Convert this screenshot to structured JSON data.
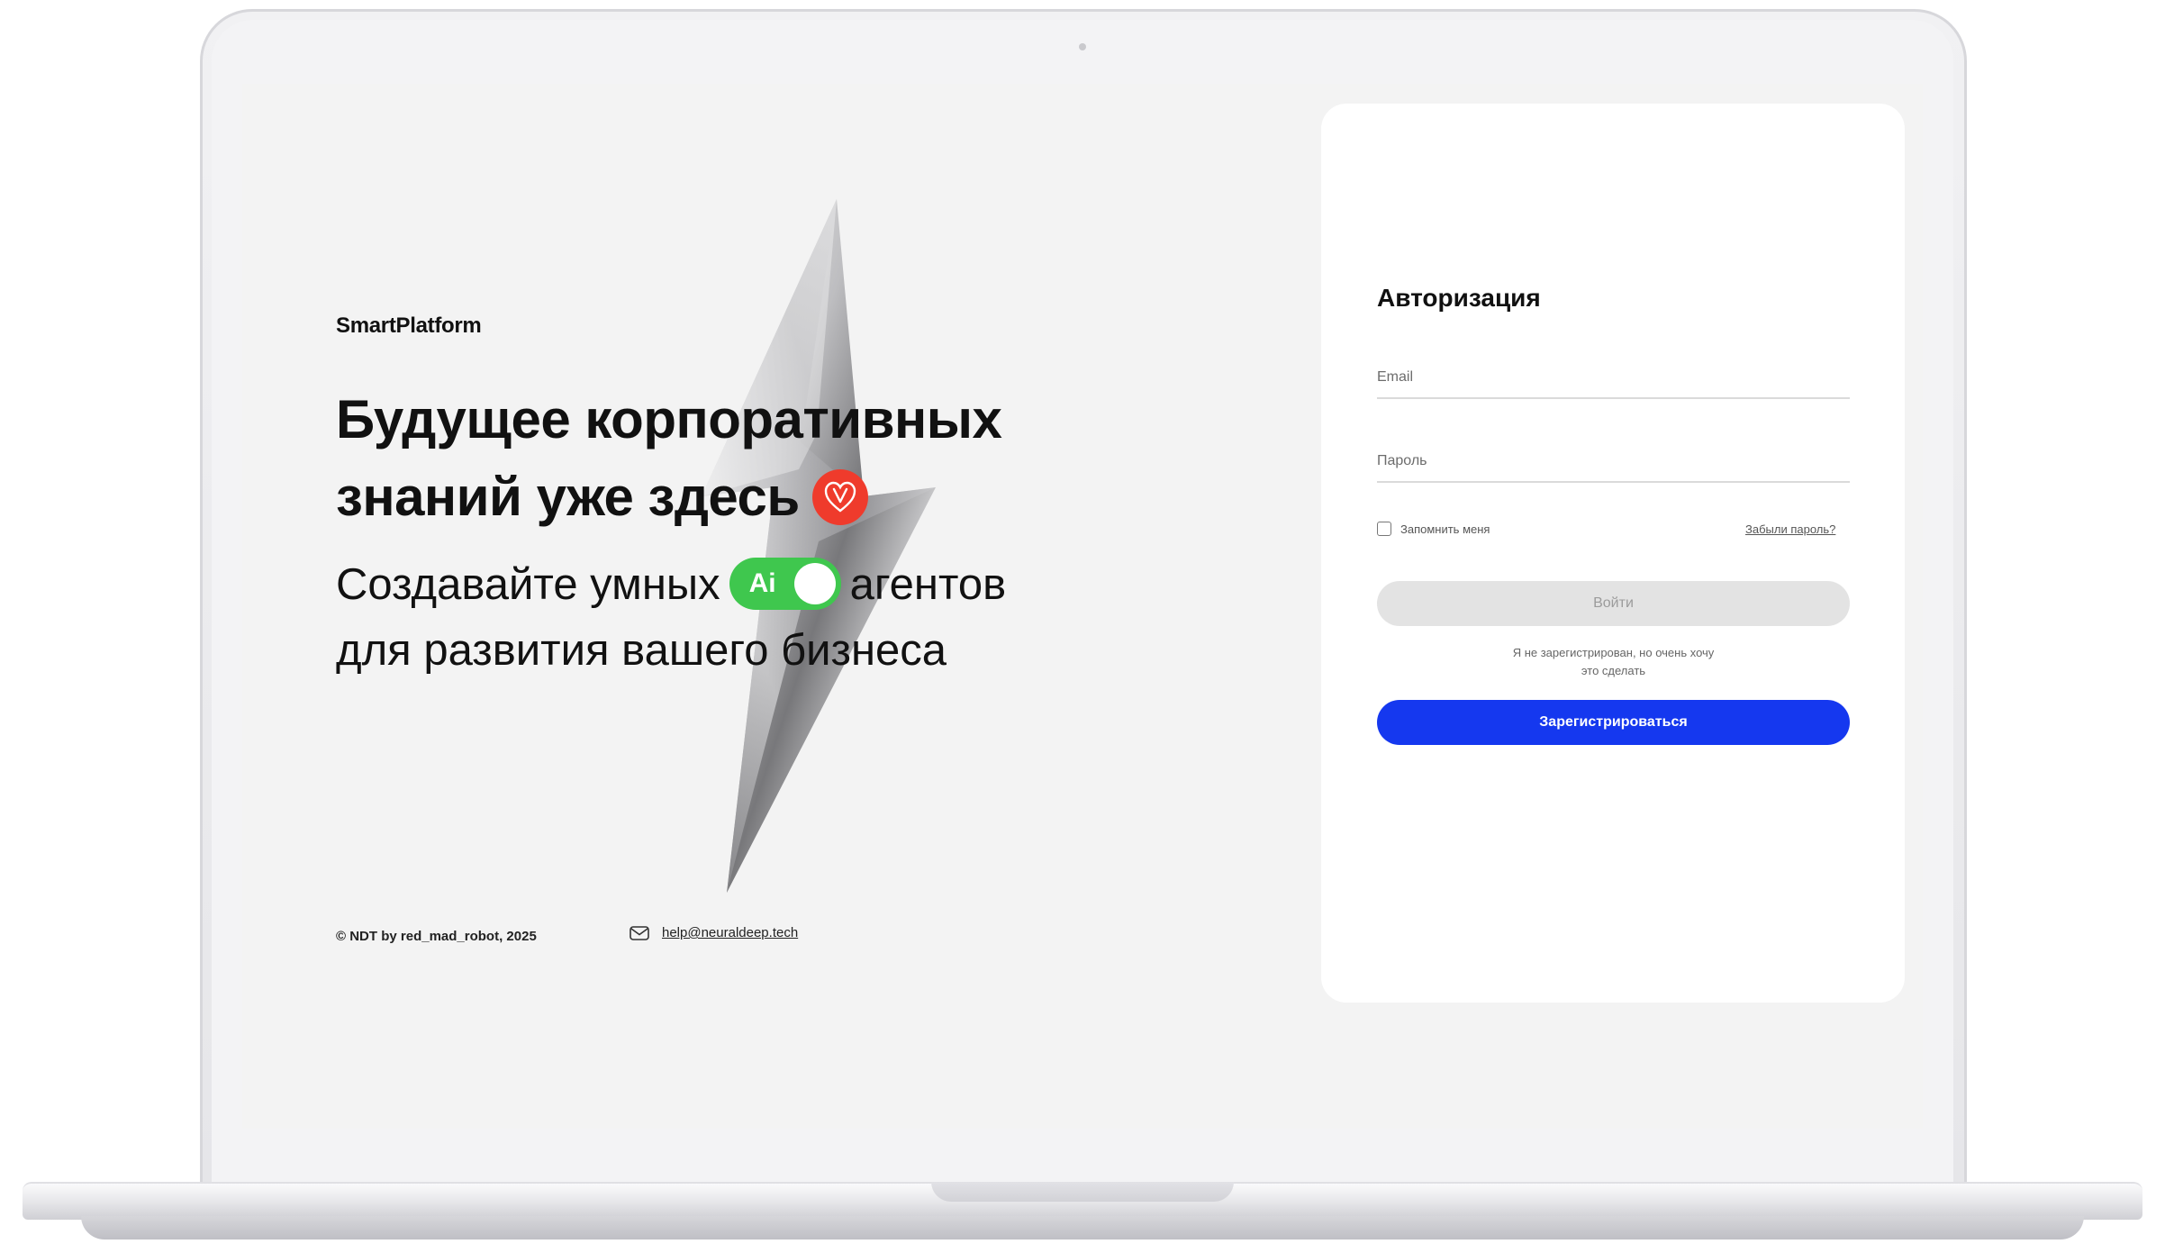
{
  "brand": {
    "name": "SmartPlatform"
  },
  "hero": {
    "headline_line1": "Будущее корпоративных",
    "headline_line2": "знаний уже здесь",
    "subline_part1": "Создавайте умных",
    "toggle_label": "Ai",
    "subline_part2": "агентов",
    "subline_line2": "для развития вашего бизнеса"
  },
  "footer": {
    "copyright": "© NDT by red_mad_robot, 2025",
    "email": "help@neuraldeep.tech"
  },
  "auth": {
    "title": "Авторизация",
    "email_placeholder": "Email",
    "password_placeholder": "Пароль",
    "remember_label": "Запомнить меня",
    "forgot_label": "Забыли пароль?",
    "login_label": "Войти",
    "hint_line1": "Я не зарегистрирован, но очень хочу",
    "hint_line2": "это сделать",
    "register_label": "Зарегистрироваться"
  },
  "colors": {
    "accent_blue": "#1538ef",
    "toggle_green": "#3fc74e",
    "heart_red": "#ef3b2c",
    "screen_bg": "#f3f3f3"
  },
  "icons": {
    "heart": "heart-icon",
    "mail": "mail-icon",
    "lightning": "lightning-bolt"
  }
}
